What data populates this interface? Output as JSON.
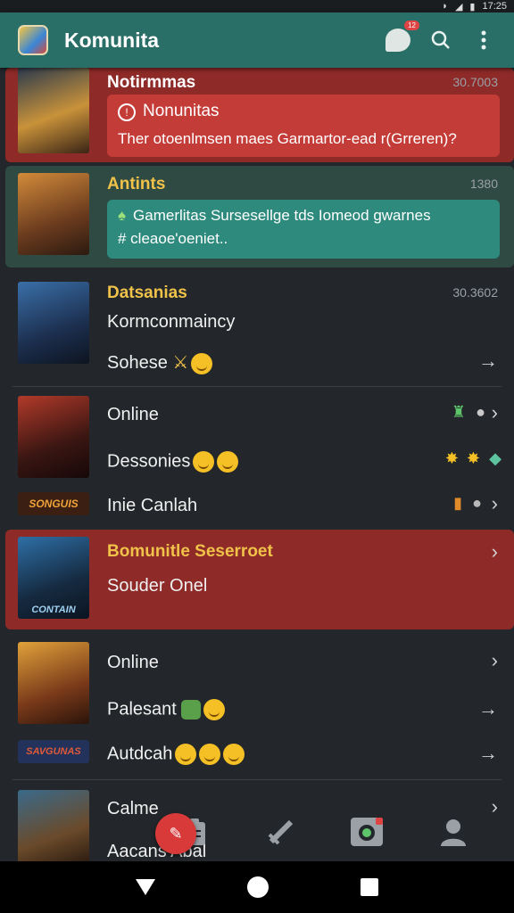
{
  "status_bar": {
    "time": "17:25"
  },
  "app_bar": {
    "title": "Komunita",
    "chat_badge": "12"
  },
  "cards": [
    {
      "name": "Notirmmas",
      "time": "30.7003",
      "msg_title": "Nonunitas",
      "msg_body": "Ther otoenlmsen maes Garmartor-ead r(Grreren)?"
    },
    {
      "name": "Antints",
      "time": "1380",
      "msg_body": "Gamerlitas Sursesellge tds Iomeod gwarnes",
      "msg_body2": "# cleaoe'oeniet.."
    },
    {
      "name": "Datsanias",
      "time": "30.3602",
      "line1": "Kormconmaincy",
      "line2": "Sohese"
    },
    {
      "line1": "Online",
      "line2": "Dessonies",
      "line3": "Inie Canlah",
      "badge3": "SONGUIS"
    },
    {
      "name": "Bomunitle Seserroet",
      "line1": "Souder Onel",
      "thumb_label": "CONTAIN"
    },
    {
      "line1": "Online",
      "line2": "Palesant",
      "line3": "Autdcah",
      "badge3": "SAVGUNAS"
    },
    {
      "line1": "Calme",
      "line2": "Aacans Abal"
    }
  ],
  "icons": {
    "search": "search-icon",
    "more": "more-vert-icon",
    "chat": "chat-icon"
  }
}
